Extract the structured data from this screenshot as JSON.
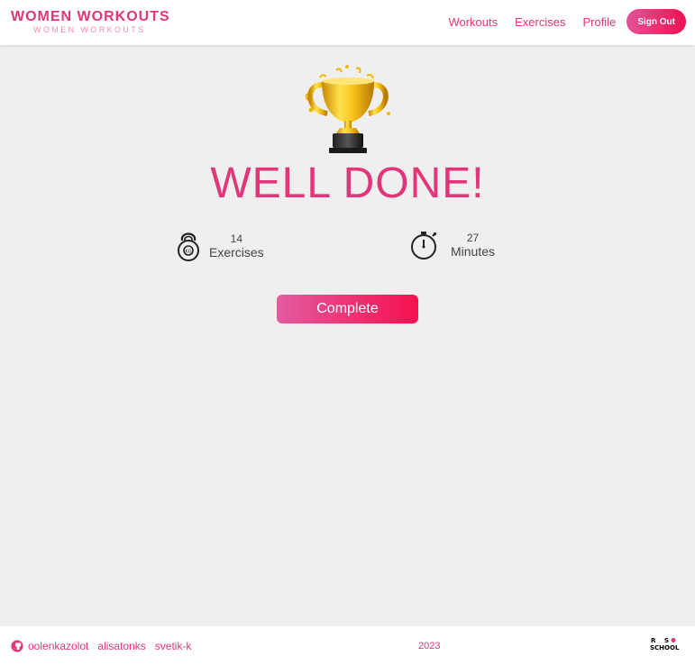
{
  "header": {
    "logo_title": "WOMEN WORKOUTS",
    "logo_subtitle": "WOMEN WORKOUTS",
    "nav": [
      {
        "label": "Workouts"
      },
      {
        "label": "Exercises"
      },
      {
        "label": "Profile"
      }
    ],
    "signout_label": "Sign Out"
  },
  "main": {
    "trophy_icon": "trophy-icon",
    "title": "WELL DONE!",
    "stats": {
      "exercises": {
        "value": "14",
        "label": "Exercises",
        "icon": "kettlebell-icon"
      },
      "minutes": {
        "value": "27",
        "label": "Minutes",
        "icon": "stopwatch-icon"
      }
    },
    "complete_label": "Complete"
  },
  "footer": {
    "authors": [
      "oolenkazolot",
      "alisatonks",
      "svetik-k"
    ],
    "year": "2023",
    "rs_logo_text": "RS SCHOOL"
  },
  "colors": {
    "accent": "#e2357a",
    "background": "#efefef",
    "button_gradient_start": "#e45aa0",
    "button_gradient_end": "#f4114e",
    "trophy_gold": "#f2b705"
  }
}
